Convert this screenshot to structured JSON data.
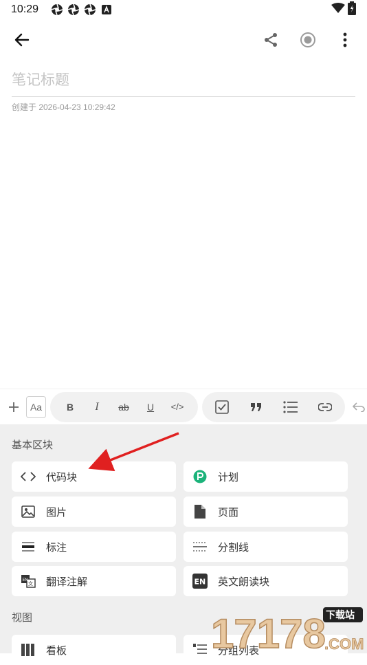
{
  "status": {
    "time": "10:29",
    "battery_icon": "battery-charging-icon",
    "wifi_icon": "wifi-icon"
  },
  "app_bar": {
    "back_icon": "arrow-left-icon",
    "share_icon": "share-icon",
    "record_icon": "record-icon",
    "more_icon": "more-vertical-icon"
  },
  "note": {
    "title_placeholder": "笔记标题",
    "created": "创建于 2026-04-23 10:29:42"
  },
  "toolbar": {
    "aa": "Aa",
    "bold": "B",
    "italic": "I",
    "strike": "ab",
    "underline": "U",
    "code": "</>"
  },
  "panel": {
    "basic_label": "基本区块",
    "view_label": "视图",
    "blocks": [
      {
        "label": "代码块",
        "icon": "code-icon"
      },
      {
        "label": "计划",
        "icon": "plan-icon"
      },
      {
        "label": "图片",
        "icon": "image-icon"
      },
      {
        "label": "页面",
        "icon": "page-icon"
      },
      {
        "label": "标注",
        "icon": "callout-icon"
      },
      {
        "label": "分割线",
        "icon": "divider-icon"
      },
      {
        "label": "翻译注解",
        "icon": "translate-icon"
      },
      {
        "label": "英文朗读块",
        "icon": "en-read-icon"
      }
    ],
    "views": [
      {
        "label": "看板",
        "icon": "kanban-icon"
      },
      {
        "label": "分组列表",
        "icon": "group-list-icon"
      }
    ]
  },
  "watermark": {
    "text": "17178",
    "badge": "下载站",
    "suffix": ".COM"
  },
  "colors": {
    "plan_green": "#1bb37a",
    "arrow_red": "#e02020"
  }
}
